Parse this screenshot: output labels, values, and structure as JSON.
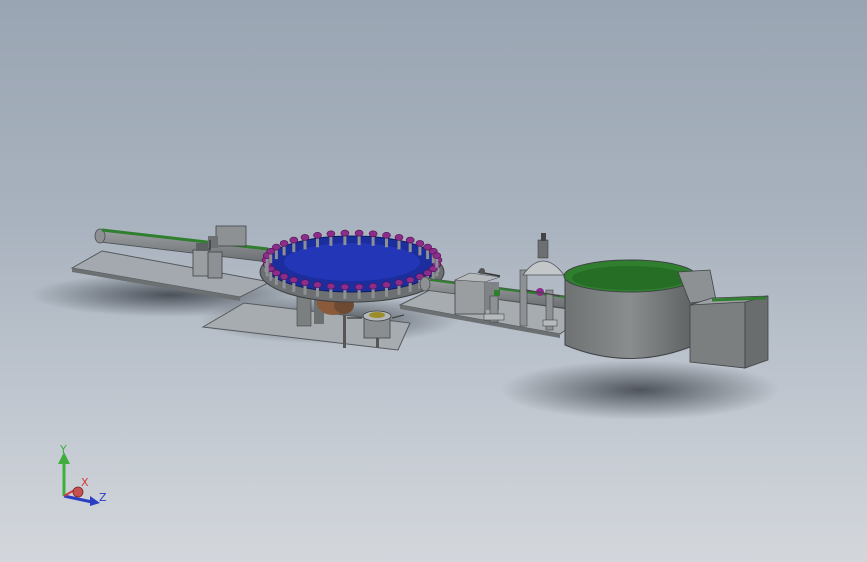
{
  "viewport": {
    "background_top": "#9aa5b3",
    "background_bottom": "#d3d7dc"
  },
  "triad": {
    "y_label": "Y",
    "x_label": "X",
    "z_label": "Z",
    "y_color": "#3fae3f",
    "x_color": "#d23a3a",
    "z_color": "#2b3fc4"
  },
  "model": {
    "parts": [
      "left-conveyor-table",
      "left-conveyor-rail",
      "left-gripper-unit",
      "rotary-turret-base-plate",
      "rotary-turret",
      "turret-holders",
      "turret-drive-motor",
      "cup-fixture",
      "middle-conveyor-table",
      "capping-station",
      "dome-dispenser",
      "vibratory-bowl-feeder",
      "feeder-chute-box"
    ],
    "colors": {
      "table": "#a3a9ae",
      "body": "#7c7f80",
      "green": "#2f7f2f",
      "blue_disc": "#1c2e9e",
      "purple": "#8e2c8e"
    }
  }
}
